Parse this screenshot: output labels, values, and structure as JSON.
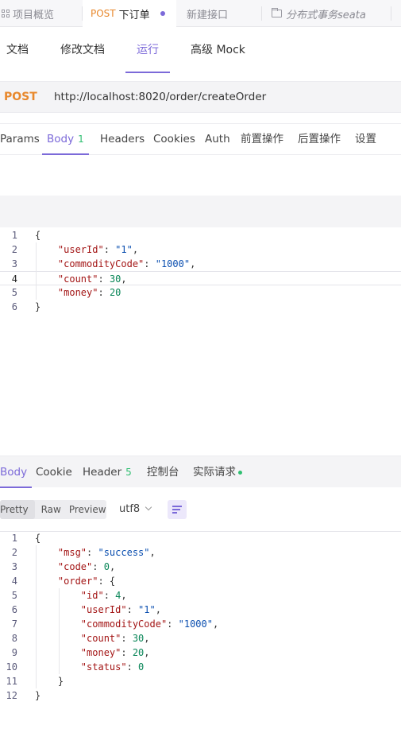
{
  "top_tabs": [
    {
      "label": "项目概览"
    },
    {
      "method": "POST",
      "label": "下订单"
    },
    {
      "label": "新建接口"
    },
    {
      "label": "分布式事务seata"
    }
  ],
  "sub_tabs": [
    "文档",
    "修改文档",
    "运行",
    "高级 Mock"
  ],
  "request": {
    "method": "POST",
    "url": "http://localhost:8020/order/createOrder"
  },
  "request_tabs": {
    "params": "Params",
    "body": "Body",
    "body_count": "1",
    "headers": "Headers",
    "cookies": "Cookies",
    "auth": "Auth",
    "pre": "前置操作",
    "post": "后置操作",
    "settings": "设置"
  },
  "request_body": {
    "line_numbers": [
      "1",
      "2",
      "3",
      "4",
      "5",
      "6"
    ],
    "lines": [
      [
        {
          "t": "{",
          "c": "p"
        }
      ],
      [
        {
          "t": "    ",
          "c": "p"
        },
        {
          "t": "\"userId\"",
          "c": "k"
        },
        {
          "t": ": ",
          "c": "p"
        },
        {
          "t": "\"1\"",
          "c": "s"
        },
        {
          "t": ",",
          "c": "p"
        }
      ],
      [
        {
          "t": "    ",
          "c": "p"
        },
        {
          "t": "\"commodityCode\"",
          "c": "k"
        },
        {
          "t": ": ",
          "c": "p"
        },
        {
          "t": "\"1000\"",
          "c": "s"
        },
        {
          "t": ",",
          "c": "p"
        }
      ],
      [
        {
          "t": "    ",
          "c": "p"
        },
        {
          "t": "\"count\"",
          "c": "k"
        },
        {
          "t": ": ",
          "c": "p"
        },
        {
          "t": "30",
          "c": "n"
        },
        {
          "t": ",",
          "c": "p"
        }
      ],
      [
        {
          "t": "    ",
          "c": "p"
        },
        {
          "t": "\"money\"",
          "c": "k"
        },
        {
          "t": ": ",
          "c": "p"
        },
        {
          "t": "20",
          "c": "n"
        }
      ],
      [
        {
          "t": "}",
          "c": "p"
        }
      ]
    ]
  },
  "response_tabs": {
    "body": "Body",
    "cookie": "Cookie",
    "header": "Header",
    "header_count": "5",
    "console": "控制台",
    "actual_request": "实际请求"
  },
  "format": {
    "pretty": "Pretty",
    "raw": "Raw",
    "preview": "Preview",
    "encoding": "utf8"
  },
  "response_body": {
    "line_numbers": [
      "1",
      "2",
      "3",
      "4",
      "5",
      "6",
      "7",
      "8",
      "9",
      "10",
      "11",
      "12"
    ],
    "lines": [
      [
        {
          "t": "{",
          "c": "p"
        }
      ],
      [
        {
          "t": "    ",
          "c": "p"
        },
        {
          "t": "\"msg\"",
          "c": "k"
        },
        {
          "t": ": ",
          "c": "p"
        },
        {
          "t": "\"success\"",
          "c": "s"
        },
        {
          "t": ",",
          "c": "p"
        }
      ],
      [
        {
          "t": "    ",
          "c": "p"
        },
        {
          "t": "\"code\"",
          "c": "k"
        },
        {
          "t": ": ",
          "c": "p"
        },
        {
          "t": "0",
          "c": "n"
        },
        {
          "t": ",",
          "c": "p"
        }
      ],
      [
        {
          "t": "    ",
          "c": "p"
        },
        {
          "t": "\"order\"",
          "c": "k"
        },
        {
          "t": ": {",
          "c": "p"
        }
      ],
      [
        {
          "t": "        ",
          "c": "p"
        },
        {
          "t": "\"id\"",
          "c": "k"
        },
        {
          "t": ": ",
          "c": "p"
        },
        {
          "t": "4",
          "c": "n"
        },
        {
          "t": ",",
          "c": "p"
        }
      ],
      [
        {
          "t": "        ",
          "c": "p"
        },
        {
          "t": "\"userId\"",
          "c": "k"
        },
        {
          "t": ": ",
          "c": "p"
        },
        {
          "t": "\"1\"",
          "c": "s"
        },
        {
          "t": ",",
          "c": "p"
        }
      ],
      [
        {
          "t": "        ",
          "c": "p"
        },
        {
          "t": "\"commodityCode\"",
          "c": "k"
        },
        {
          "t": ": ",
          "c": "p"
        },
        {
          "t": "\"1000\"",
          "c": "s"
        },
        {
          "t": ",",
          "c": "p"
        }
      ],
      [
        {
          "t": "        ",
          "c": "p"
        },
        {
          "t": "\"count\"",
          "c": "k"
        },
        {
          "t": ": ",
          "c": "p"
        },
        {
          "t": "30",
          "c": "n"
        },
        {
          "t": ",",
          "c": "p"
        }
      ],
      [
        {
          "t": "        ",
          "c": "p"
        },
        {
          "t": "\"money\"",
          "c": "k"
        },
        {
          "t": ": ",
          "c": "p"
        },
        {
          "t": "20",
          "c": "n"
        },
        {
          "t": ",",
          "c": "p"
        }
      ],
      [
        {
          "t": "        ",
          "c": "p"
        },
        {
          "t": "\"status\"",
          "c": "k"
        },
        {
          "t": ": ",
          "c": "p"
        },
        {
          "t": "0",
          "c": "n"
        }
      ],
      [
        {
          "t": "    }",
          "c": "p"
        }
      ],
      [
        {
          "t": "}",
          "c": "p"
        }
      ]
    ]
  },
  "colors": {
    "accent": "#7c6ad9",
    "post": "#e8882c",
    "success": "#2fbf71",
    "json_key": "#a31515",
    "json_string": "#0b4fb0",
    "json_number": "#098658"
  },
  "icons": {
    "overview": "grid-icon",
    "folder": "folder-icon",
    "unsaved": "dot-icon",
    "wrap": "wrap-lines-icon",
    "dropdown": "chevron-down-icon"
  }
}
